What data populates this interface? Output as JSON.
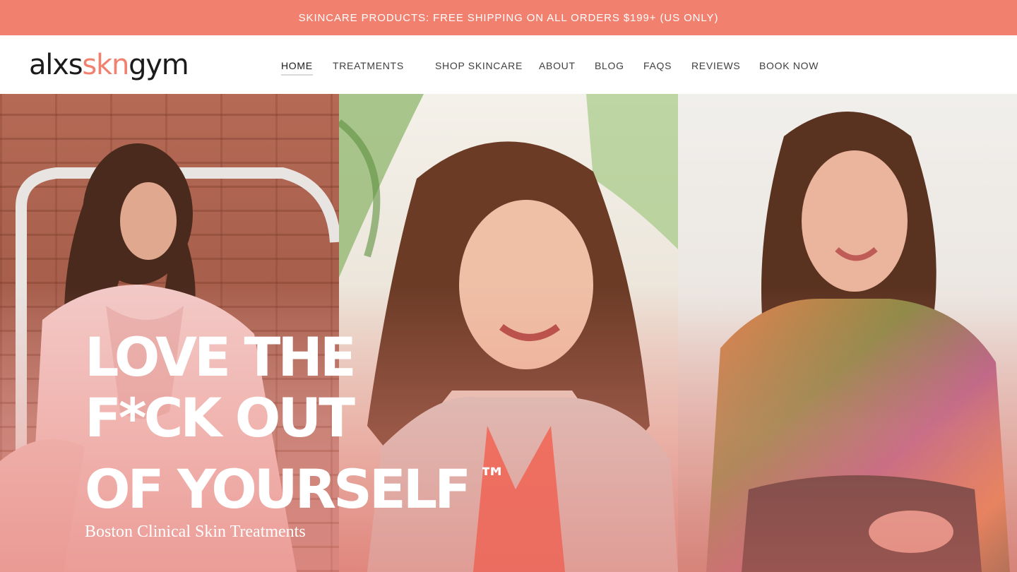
{
  "announcement": {
    "text": "SKINCARE PRODUCTS: FREE SHIPPING ON ALL ORDERS $199+ (US ONLY)"
  },
  "logo": {
    "part1": "alxs",
    "part2": "skn",
    "part3": "gym"
  },
  "nav": {
    "items": [
      {
        "label": "HOME",
        "active": true
      },
      {
        "label": "TREATMENTS"
      },
      {
        "label": "SHOP SKINCARE"
      },
      {
        "label": "ABOUT"
      },
      {
        "label": "BLOG"
      },
      {
        "label": "FAQS"
      },
      {
        "label": "REVIEWS"
      },
      {
        "label": "BOOK NOW"
      }
    ]
  },
  "hero": {
    "headline_line1": "LOVE THE",
    "headline_line2": "F*CK OUT",
    "headline_line3": "OF YOURSELF",
    "trademark": "™",
    "subheadline": "Boston Clinical Skin Treatments"
  },
  "colors": {
    "accent": "#f2806f",
    "text_dark": "#1b1b1b",
    "white": "#ffffff"
  }
}
